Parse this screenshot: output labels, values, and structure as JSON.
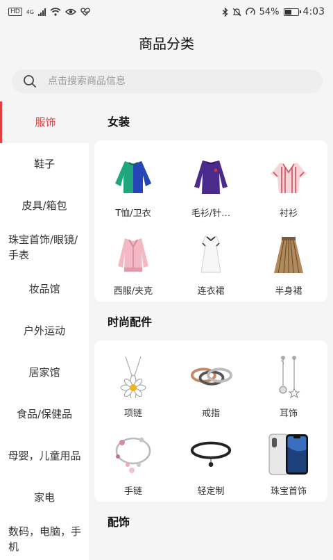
{
  "status_bar": {
    "hd": "HD",
    "network": "4G",
    "battery": "54%",
    "battery_level": 0.54,
    "time": "4:03"
  },
  "header": {
    "title": "商品分类"
  },
  "search": {
    "placeholder": "点击搜索商品信息"
  },
  "sidebar": {
    "items": [
      {
        "label": "服饰"
      },
      {
        "label": "鞋子"
      },
      {
        "label": "皮具/箱包"
      },
      {
        "label": "珠宝首饰/眼镜/手表"
      },
      {
        "label": "妆品馆"
      },
      {
        "label": "户外运动"
      },
      {
        "label": "居家馆"
      },
      {
        "label": "食品/保健品"
      },
      {
        "label": "母婴，儿童用品"
      },
      {
        "label": "家电"
      },
      {
        "label": "数码，电脑，手机"
      }
    ]
  },
  "sections": [
    {
      "title": "女装",
      "items": [
        {
          "label": "T恤/卫衣",
          "icon": "sweatshirt-icon"
        },
        {
          "label": "毛衫/针…",
          "icon": "sweater-icon"
        },
        {
          "label": "衬衫",
          "icon": "blouse-icon"
        },
        {
          "label": "西服/夹克",
          "icon": "jacket-icon"
        },
        {
          "label": "连衣裙",
          "icon": "dress-icon"
        },
        {
          "label": "半身裙",
          "icon": "skirt-icon"
        }
      ]
    },
    {
      "title": "时尚配件",
      "items": [
        {
          "label": "项链",
          "icon": "necklace-icon"
        },
        {
          "label": "戒指",
          "icon": "ring-icon"
        },
        {
          "label": "耳饰",
          "icon": "earring-icon"
        },
        {
          "label": "手链",
          "icon": "bracelet-icon"
        },
        {
          "label": "轻定制",
          "icon": "choker-icon"
        },
        {
          "label": "珠宝首饰",
          "icon": "phone-icon"
        }
      ]
    },
    {
      "title": "配饰"
    }
  ],
  "colors": {
    "accent": "#e04040"
  }
}
